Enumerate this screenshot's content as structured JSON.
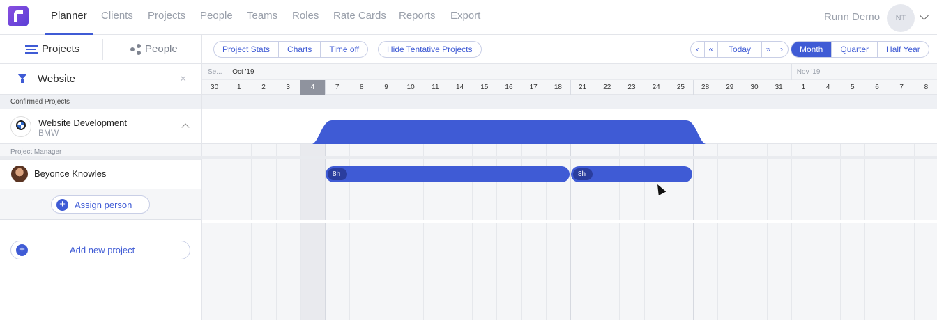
{
  "nav": {
    "items": [
      "Planner",
      "Clients",
      "Projects",
      "People",
      "Teams",
      "Roles",
      "Rate Cards",
      "Reports",
      "Export"
    ],
    "active": "Planner",
    "user_label": "Runn Demo",
    "avatar_initials": "NT"
  },
  "toolbar": {
    "projects_tab": "Projects",
    "people_tab": "People",
    "stats_buttons": [
      "Project Stats",
      "Charts",
      "Time off"
    ],
    "hide_tentative": "Hide Tentative Projects",
    "prev_label": "‹",
    "prev_fast_label": "«",
    "today_label": "Today",
    "next_fast_label": "»",
    "next_label": "›",
    "views": [
      "Month",
      "Quarter",
      "Half Year"
    ],
    "active_view": "Month"
  },
  "filter": {
    "value": "Website",
    "clear_label": "×"
  },
  "groups": {
    "confirmed": "Confirmed Projects"
  },
  "project": {
    "name": "Website Development",
    "client": "BMW",
    "role_header": "Project Manager",
    "person": "Beyonce Knowles",
    "assign_label": "Assign person"
  },
  "add_project_label": "Add new project",
  "timeline": {
    "months": [
      {
        "label": "Se...",
        "first_index": 0,
        "dim": true
      },
      {
        "label": "Oct '19",
        "first_index": 1,
        "dim": false
      },
      {
        "label": "Nov '19",
        "first_index": 24,
        "dim": true
      }
    ],
    "days": [
      "30",
      "1",
      "2",
      "3",
      "4",
      "7",
      "8",
      "9",
      "10",
      "11",
      "14",
      "15",
      "16",
      "17",
      "18",
      "21",
      "22",
      "23",
      "24",
      "25",
      "28",
      "29",
      "30",
      "31",
      "1",
      "4",
      "5",
      "6",
      "7",
      "8"
    ],
    "today_index": 4,
    "project_span": {
      "start_index": 5,
      "end_index": 19
    },
    "assignments": [
      {
        "start_index": 5,
        "end_index": 14,
        "hours_label": "8h"
      },
      {
        "start_index": 15,
        "end_index": 19,
        "hours_label": "8h"
      }
    ]
  },
  "colors": {
    "accent": "#3f5bd5",
    "bar_dark": "#2a3d9e",
    "grid": "#e6e8ec",
    "today": "#8f939e"
  }
}
